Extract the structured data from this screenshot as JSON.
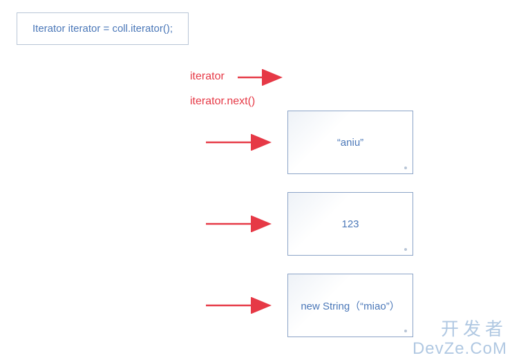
{
  "code_declaration": "Iterator iterator = coll.iterator();",
  "labels": {
    "iterator": "iterator",
    "iterator_next": "iterator.next()"
  },
  "boxes": [
    {
      "value": "“aniu”"
    },
    {
      "value": "123"
    },
    {
      "value": "new  String（“miao”）"
    }
  ],
  "watermark": {
    "cn": "开发者",
    "en": "DevZe.CoM"
  },
  "colors": {
    "arrow": "#e63946",
    "label": "#e63946",
    "box_text": "#4a77b8",
    "box_border": "#8ba3c7"
  }
}
